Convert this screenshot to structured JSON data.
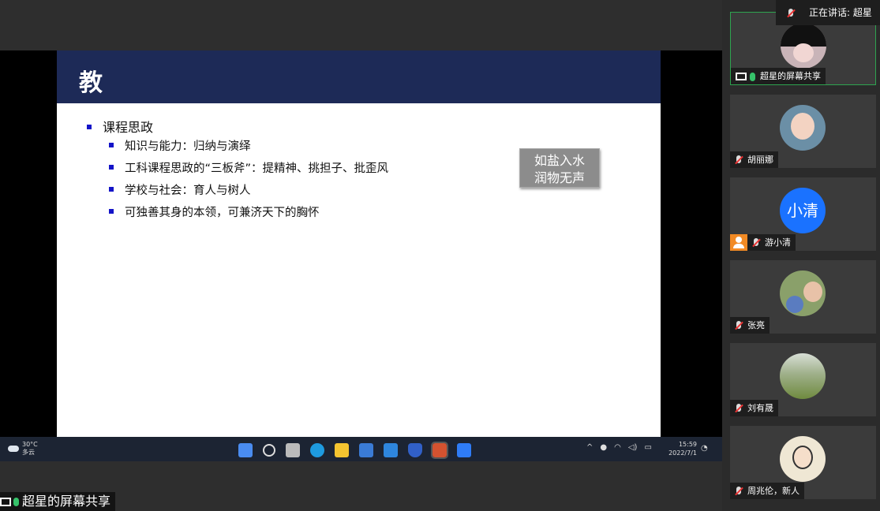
{
  "slide": {
    "title": "教",
    "main_bullet": "课程思政",
    "sub_bullets": [
      "知识与能力：归纳与演绎",
      "工科课程思政的“三板斧”：提精神、挑担子、批歪风",
      "学校与社会：育人与树人",
      "可独善其身的本领，可兼济天下的胸怀"
    ],
    "badge_line1": "如盐入水",
    "badge_line2": "润物无声"
  },
  "taskbar": {
    "temperature": "30°C",
    "weather": "多云",
    "time": "15:59",
    "date": "2022/7/1",
    "icons": [
      "start-icon",
      "search-icon",
      "task-view-icon",
      "edge-icon",
      "explorer-icon",
      "store-icon",
      "mail-icon",
      "shield-app-icon",
      "powerpoint-icon",
      "tencent-meeting-icon"
    ]
  },
  "share_label": "超星的屏幕共享",
  "speaking": "正在讲话: 超星",
  "participants": [
    {
      "name": "超星的屏幕共享",
      "avatar": "anime-avatar",
      "active": true
    },
    {
      "name": "胡丽娜",
      "avatar": "photo-avatar"
    },
    {
      "name": "游小清",
      "avatar_text": "小清"
    },
    {
      "name": "张亮",
      "avatar": "photo-avatar"
    },
    {
      "name": "刘有晟",
      "avatar": "photo-avatar"
    },
    {
      "name": "周兆伦，新人",
      "avatar": "photo-avatar"
    }
  ],
  "colors": {
    "slide_header": "#1d2a57",
    "bullet": "#1414c8",
    "active_border": "#2ea44f",
    "avatar_blue": "#1a72ff"
  }
}
